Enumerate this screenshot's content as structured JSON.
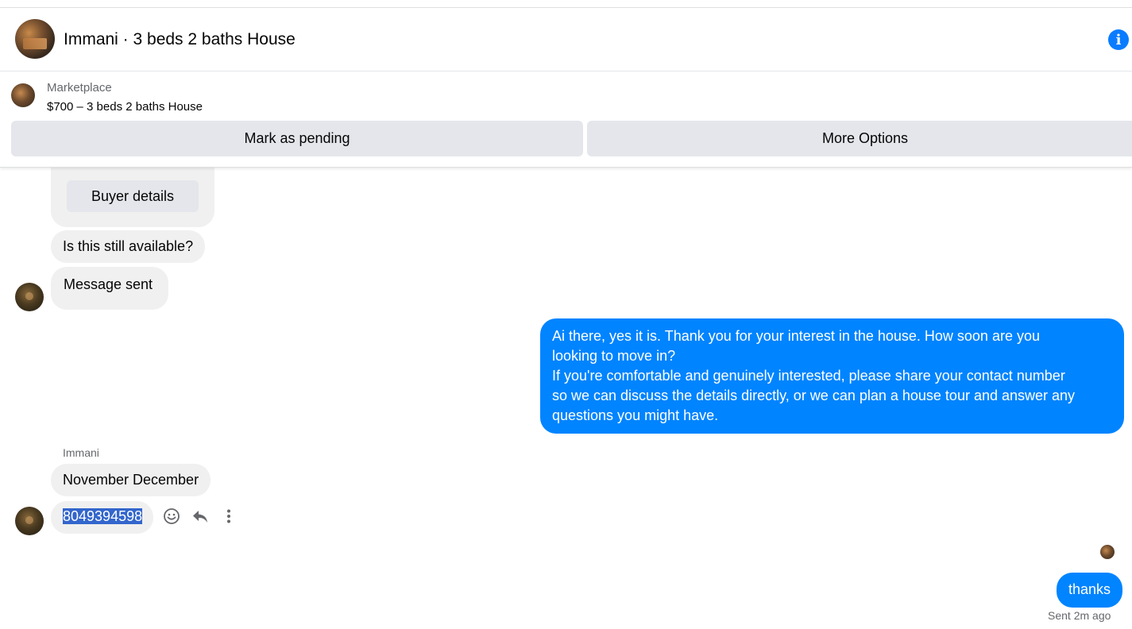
{
  "header": {
    "title": "Immani · 3 beds 2 baths House",
    "info_icon": "info-icon"
  },
  "marketplace": {
    "label": "Marketplace",
    "listing": "$700 – 3 beds 2 baths House",
    "mark_pending_label": "Mark as pending",
    "more_options_label": "More Options"
  },
  "chat": {
    "buyer_details_label": "Buyer details",
    "sender_name": "Immani",
    "messages": [
      {
        "from": "buyer",
        "text": "Is this still available?"
      },
      {
        "from": "buyer",
        "text": "Message sent"
      },
      {
        "from": "me",
        "lines": [
          "Ai there, yes it is. Thank you for your interest in the house. How soon are you",
          "looking to move in?",
          "If you're comfortable and genuinely interested, please share your contact number",
          "so we can discuss the details directly, or we can plan a house tour and answer any",
          "questions you might have."
        ]
      },
      {
        "from": "buyer",
        "text": "November December"
      },
      {
        "from": "buyer",
        "text": "8049394598"
      },
      {
        "from": "me",
        "text": "thanks"
      }
    ],
    "status": "Sent 2m ago",
    "colors": {
      "outgoing": "#0084ff",
      "incoming": "#f0f0f0",
      "selection": "#3366cc"
    }
  }
}
